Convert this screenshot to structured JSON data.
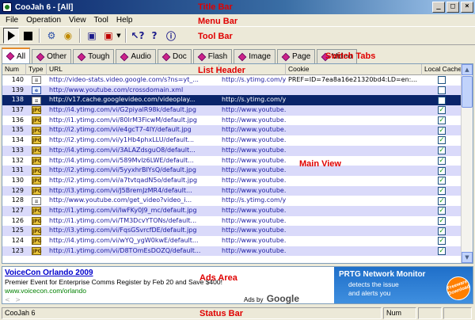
{
  "window": {
    "title": "CooJah 6 - [All]"
  },
  "annotations": {
    "title_bar": "Title Bar",
    "menu_bar": "Menu Bar",
    "tool_bar": "Tool Bar",
    "switch_tabs": "Switch Tabs",
    "list_header": "List Header",
    "main_view": "Main View",
    "ads_area": "Ads Area",
    "status_bar": "Status Bar"
  },
  "menu": [
    "File",
    "Operation",
    "View",
    "Tool",
    "Help"
  ],
  "tabs": [
    "All",
    "Other",
    "Tough",
    "Audio",
    "Doc",
    "Flash",
    "Image",
    "Page",
    "Video"
  ],
  "columns": {
    "num": "Num",
    "type": "Type",
    "url": "URL",
    "referer": "",
    "cookie": "Cookie",
    "cache": "Local Cache"
  },
  "rows": [
    {
      "num": "140",
      "type": "doc",
      "url": "http://video-stats.video.google.com/s?ns=yt_...",
      "referer": "http://s.ytimg.com/yt/s...",
      "cookie": "PREF=ID=7ea8a16e21320bd4:LD=en:...",
      "cached": false
    },
    {
      "num": "139",
      "type": "ie",
      "url": "http://www.youtube.com/crossdomain.xml",
      "referer": "",
      "cookie": "",
      "cached": false
    },
    {
      "num": "138",
      "type": "doc",
      "url": "http://v17.cache.googlevideo.com/videoplay...",
      "referer": "http://s.ytimg.com/yt/s...",
      "cookie": "",
      "cached": false
    },
    {
      "num": "137",
      "type": "img",
      "url": "http://i4.ytimg.com/vi/G2piyalR98k/default.jpg",
      "referer": "http://www.youtube.com...",
      "cookie": "",
      "cached": true
    },
    {
      "num": "136",
      "type": "img",
      "url": "http://i1.ytimg.com/vi/80IrM3FicwM/default.jpg",
      "referer": "http://www.youtube.com...",
      "cookie": "",
      "cached": true
    },
    {
      "num": "135",
      "type": "img",
      "url": "http://i2.ytimg.com/vi/e4gcT7-4IY/default.jpg",
      "referer": "http://www.youtube.com...",
      "cookie": "",
      "cached": true
    },
    {
      "num": "134",
      "type": "img",
      "url": "http://i2.ytimg.com/vi/y1Hb4phxLLU/default...",
      "referer": "http://www.youtube.com...",
      "cookie": "",
      "cached": true
    },
    {
      "num": "133",
      "type": "img",
      "url": "http://i4.ytimg.com/vi/3ALAZdsguO8/default...",
      "referer": "http://www.youtube.com...",
      "cookie": "",
      "cached": true
    },
    {
      "num": "132",
      "type": "img",
      "url": "http://i4.ytimg.com/vi/589Mvlz6LWE/default...",
      "referer": "http://www.youtube.com...",
      "cookie": "",
      "cached": true
    },
    {
      "num": "131",
      "type": "img",
      "url": "http://i2.ytimg.com/vi/5yyxhrBIYsQ/default.jpg",
      "referer": "http://www.youtube.com...",
      "cookie": "",
      "cached": true
    },
    {
      "num": "130",
      "type": "img",
      "url": "http://i2.ytimg.com/vi/a7tvtqadN5o/default.jpg",
      "referer": "http://www.youtube.com...",
      "cookie": "",
      "cached": true
    },
    {
      "num": "129",
      "type": "img",
      "url": "http://i3.ytimg.com/vi/J5BremJzMR4/default...",
      "referer": "http://www.youtube.com...",
      "cookie": "",
      "cached": true
    },
    {
      "num": "128",
      "type": "doc",
      "url": "http://www.youtube.com/get_video?video_i...",
      "referer": "http://s.ytimg.com/yt/s...",
      "cookie": "",
      "cached": true
    },
    {
      "num": "127",
      "type": "img",
      "url": "http://i1.ytimg.com/vi/lwFKy0J9_mc/default.jpg",
      "referer": "http://www.youtube.com...",
      "cookie": "",
      "cached": true
    },
    {
      "num": "126",
      "type": "img",
      "url": "http://i1.ytimg.com/vi/TM3DcvYTONs/default...",
      "referer": "http://www.youtube.com...",
      "cookie": "",
      "cached": true
    },
    {
      "num": "125",
      "type": "img",
      "url": "http://i3.ytimg.com/vi/FqsGSvrcfDE/default.jpg",
      "referer": "http://www.youtube.com...",
      "cookie": "",
      "cached": true
    },
    {
      "num": "124",
      "type": "img",
      "url": "http://i4.ytimg.com/vi/wYQ_ygW0kwE/default...",
      "referer": "http://www.youtube.com...",
      "cookie": "",
      "cached": true
    },
    {
      "num": "123",
      "type": "img",
      "url": "http://i1.ytimg.com/vi/D8TOmEsDOZQ/default...",
      "referer": "http://www.youtube.com...",
      "cookie": "",
      "cached": true
    }
  ],
  "selected_row": "138",
  "ads": {
    "title": "VoiceCon Orlando 2009",
    "desc": "Premier Event for Enterprise Comms Register by Feb 20 and Save $400!",
    "url": "www.voicecon.com/orlando",
    "nav": "< >",
    "ads_by": "Ads by",
    "google": "Google",
    "right_title": "PRTG Network Monitor",
    "right_line1": "detects the issue",
    "right_line2": "and alerts you",
    "badge": "Freeware Download"
  },
  "status": {
    "left": "CooJah 6",
    "num": "Num"
  },
  "icons": {
    "play": "play-icon",
    "stop": "stop-icon",
    "config": "config-icon",
    "filter": "filter-icon",
    "save": "save-icon",
    "red-save": "red-save-icon",
    "help": "help-icon",
    "question": "question-icon",
    "info": "info-icon"
  }
}
